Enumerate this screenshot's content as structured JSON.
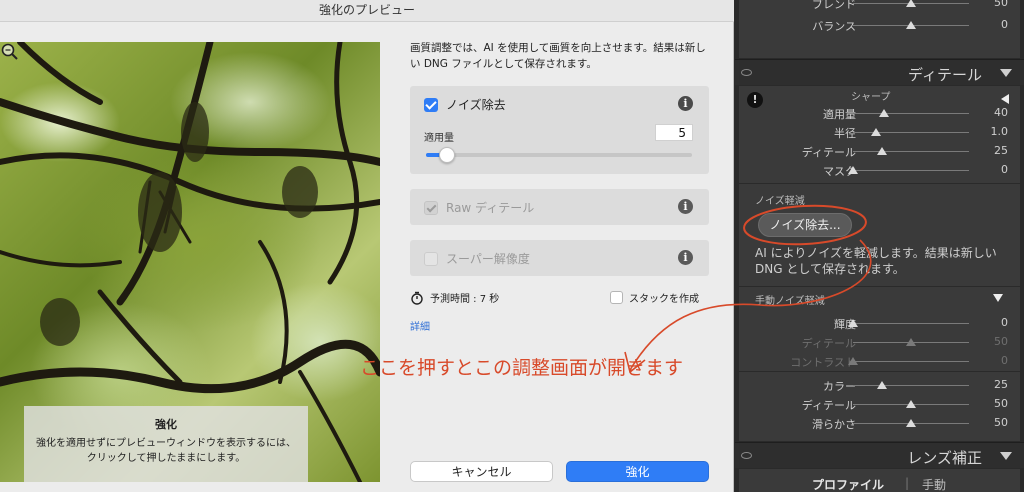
{
  "dialog": {
    "title": "強化のプレビュー",
    "description": "画質調整では、AI を使用して画質を向上させます。結果は新しい DNG ファイルとして保存されます。",
    "preview_caption_title": "強化",
    "preview_caption_body": "強化を適用せずにプレビューウィンドウを表示するには、クリックして押したままにします。",
    "options": {
      "noise": {
        "label": "ノイズ除去",
        "checked": true,
        "amount_label": "適用量",
        "amount_value": "5",
        "amount_level_percent": 5
      },
      "raw": {
        "label": "Raw ディテール",
        "checked": true,
        "disabled": true
      },
      "super": {
        "label": "スーパー解像度",
        "checked": false,
        "disabled": true
      }
    },
    "estimate_label": "予測時間 : 7 秒",
    "stack_label": "スタックを作成",
    "details_link": "詳細",
    "cancel_button": "キャンセル",
    "enhance_button": "強化",
    "accent_color": "#2f7df6"
  },
  "panel": {
    "top_sliders": [
      {
        "label": "ブレンド",
        "value": "50",
        "level": 0.5
      },
      {
        "label": "バランス",
        "value": "0",
        "level": 0.5
      }
    ],
    "detail_section": {
      "title": "ディテール",
      "sharpen_label": "シャープ",
      "sharpen_sliders": [
        {
          "label": "適用量",
          "value": "40",
          "level": 0.27
        },
        {
          "label": "半径",
          "value": "1.0",
          "level": 0.2
        },
        {
          "label": "ディテール",
          "value": "25",
          "level": 0.25
        },
        {
          "label": "マスク",
          "value": "0",
          "level": 0.0
        }
      ],
      "noise_reduction_label": "ノイズ軽減",
      "denoise_button": "ノイズ除去...",
      "denoise_description": "AI によりノイズを軽減します。結果は新しい DNG として保存されます。",
      "manual_label": "手動ノイズ軽減",
      "luminance_sliders": [
        {
          "label": "輝度",
          "value": "0",
          "level": 0.0,
          "dim": false
        },
        {
          "label": "ディテール",
          "value": "50",
          "level": 0.5,
          "dim": true
        },
        {
          "label": "コントラスト",
          "value": "0",
          "level": 0.0,
          "dim": true
        }
      ],
      "color_sliders": [
        {
          "label": "カラー",
          "value": "25",
          "level": 0.25
        },
        {
          "label": "ディテール",
          "value": "50",
          "level": 0.5
        },
        {
          "label": "滑らかさ",
          "value": "50",
          "level": 0.5
        }
      ]
    },
    "lens_section": {
      "title": "レンズ補正"
    },
    "tabs": [
      "プロファイル",
      "手動"
    ]
  },
  "annotation": {
    "text": "ここを押すとこの調整画面が開きます",
    "color": "#d84a2a"
  }
}
